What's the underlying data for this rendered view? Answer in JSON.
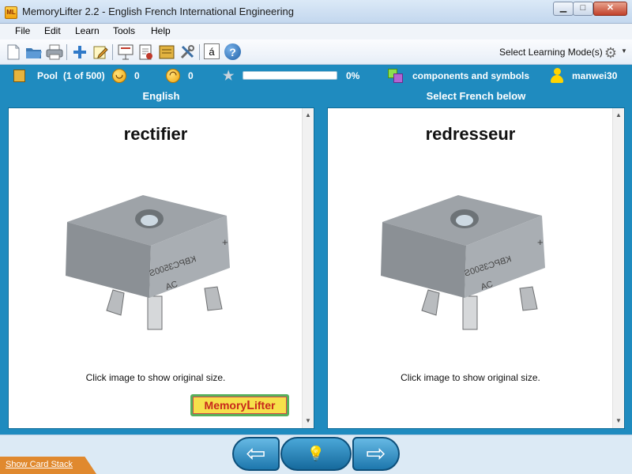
{
  "window": {
    "app_icon_text": "ML",
    "title": "MemoryLifter 2.2 - English French International Engineering",
    "minimize_glyph": "▁",
    "maximize_glyph": "□",
    "close_glyph": "✕"
  },
  "menu": [
    "File",
    "Edit",
    "Learn",
    "Tools",
    "Help"
  ],
  "toolbar": {
    "icons": [
      "new-file-icon",
      "open-folder-icon",
      "print-icon",
      "add-card-icon",
      "edit-card-icon",
      "slideshow-icon",
      "statistics-icon",
      "card-box-icon",
      "settings-tools-icon",
      "special-characters-icon",
      "help-icon"
    ],
    "special_char_label": "á",
    "help_label": "?",
    "learning_mode_label": "Select Learning Mode(s)"
  },
  "status": {
    "pool_label": "Pool",
    "pool_count": "(1 of 500)",
    "correct_count": "0",
    "wrong_count": "0",
    "progress_fraction": 0,
    "progress_text": "0%",
    "chapter": "components and symbols",
    "user": "manwei30"
  },
  "question": {
    "header": "English",
    "word": "rectifier",
    "image_hint": "Click image to show original size."
  },
  "answer": {
    "header": "Select French below",
    "word": "redresseur",
    "image_hint": "Click image to show original size."
  },
  "logo": {
    "text_memory": "Memory",
    "text_lifter_l": "L",
    "text_lifter_rest": "ifter"
  },
  "image": {
    "part_marking": "KBPC3500S",
    "plus_sign": "+",
    "ac_mark": "AC"
  },
  "navigation": {
    "prev_glyph": "⇦",
    "hint_glyph": "💡",
    "next_glyph": "⇨",
    "show_card_stack": "Show Card Stack"
  },
  "colors": {
    "accent_blue": "#1f8bbf",
    "card_border": "#0f6c98",
    "stack_tab": "#e0892e"
  }
}
